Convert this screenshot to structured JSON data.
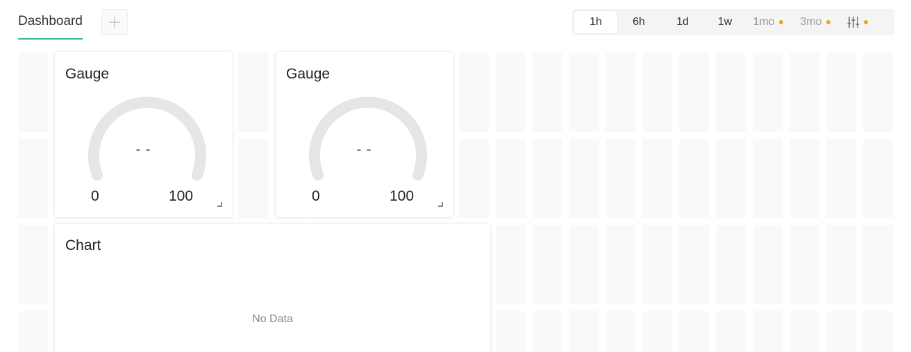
{
  "header": {
    "tab_label": "Dashboard",
    "add_tab_icon": "plus-icon",
    "time_ranges": [
      {
        "label": "1h",
        "active": true,
        "premium": false
      },
      {
        "label": "6h",
        "active": false,
        "premium": false
      },
      {
        "label": "1d",
        "active": false,
        "premium": false
      },
      {
        "label": "1w",
        "active": false,
        "premium": false
      },
      {
        "label": "1mo",
        "active": false,
        "premium": true
      },
      {
        "label": "3mo",
        "active": false,
        "premium": true
      }
    ],
    "custom_range_icon": "sliders-icon"
  },
  "widgets": {
    "gauge1": {
      "title": "Gauge",
      "value": "--",
      "min": "0",
      "max": "100"
    },
    "gauge2": {
      "title": "Gauge",
      "value": "--",
      "min": "0",
      "max": "100"
    },
    "chart": {
      "title": "Chart",
      "empty_text": "No Data"
    }
  },
  "colors": {
    "accent": "#3bb78f",
    "premium_dot": "#f5a023",
    "gauge_track": "#e6e6e6",
    "grid_cell": "#f9f9f9"
  }
}
